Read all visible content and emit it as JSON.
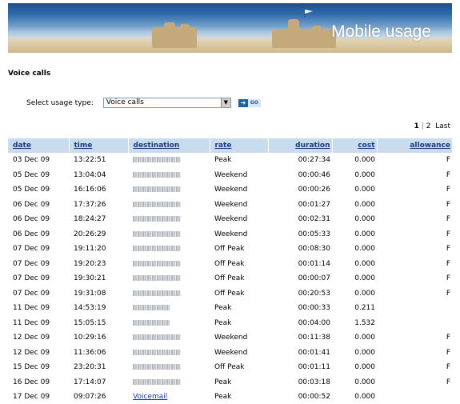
{
  "banner": {
    "title": "Mobile usage"
  },
  "section": {
    "title": "Voice calls"
  },
  "usage_selector": {
    "label": "Select usage type:",
    "value": "Voice calls",
    "go_label": "GO"
  },
  "pager": {
    "current": "1",
    "other": "2",
    "last": "Last"
  },
  "table": {
    "headers": {
      "date": "date",
      "time": "time",
      "destination": "destination",
      "rate": "rate",
      "duration": "duration",
      "cost": "cost",
      "allowance": "allowance"
    },
    "rows": [
      {
        "date": "03 Dec 09",
        "time": "13:22:51",
        "rate": "Peak",
        "duration": "00:27:34",
        "cost": "0.000",
        "allowance": "F"
      },
      {
        "date": "05 Dec 09",
        "time": "13:04:04",
        "rate": "Weekend",
        "duration": "00:00:46",
        "cost": "0.000",
        "allowance": "F"
      },
      {
        "date": "05 Dec 09",
        "time": "16:16:06",
        "rate": "Weekend",
        "duration": "00:00:26",
        "cost": "0.000",
        "allowance": "F"
      },
      {
        "date": "06 Dec 09",
        "time": "17:37:26",
        "rate": "Weekend",
        "duration": "00:01:27",
        "cost": "0.000",
        "allowance": "F"
      },
      {
        "date": "06 Dec 09",
        "time": "18:24:27",
        "rate": "Weekend",
        "duration": "00:02:31",
        "cost": "0.000",
        "allowance": "F"
      },
      {
        "date": "06 Dec 09",
        "time": "20:26:29",
        "rate": "Weekend",
        "duration": "00:05:33",
        "cost": "0.000",
        "allowance": "F"
      },
      {
        "date": "07 Dec 09",
        "time": "19:11:20",
        "rate": "Off Peak",
        "duration": "00:08:30",
        "cost": "0.000",
        "allowance": "F"
      },
      {
        "date": "07 Dec 09",
        "time": "19:20:23",
        "rate": "Off Peak",
        "duration": "00:01:14",
        "cost": "0.000",
        "allowance": "F"
      },
      {
        "date": "07 Dec 09",
        "time": "19:30:21",
        "rate": "Off Peak",
        "duration": "00:00:07",
        "cost": "0.000",
        "allowance": "F"
      },
      {
        "date": "07 Dec 09",
        "time": "19:31:08",
        "rate": "Off Peak",
        "duration": "00:20:53",
        "cost": "0.000",
        "allowance": "F"
      },
      {
        "date": "11 Dec 09",
        "time": "14:53:19",
        "rate": "Peak",
        "duration": "00:00:33",
        "cost": "0.211",
        "allowance": ""
      },
      {
        "date": "11 Dec 09",
        "time": "15:05:15",
        "rate": "Peak",
        "duration": "00:04:00",
        "cost": "1.532",
        "allowance": ""
      },
      {
        "date": "12 Dec 09",
        "time": "10:29:16",
        "rate": "Weekend",
        "duration": "00:11:38",
        "cost": "0.000",
        "allowance": "F"
      },
      {
        "date": "12 Dec 09",
        "time": "11:36:06",
        "rate": "Weekend",
        "duration": "00:01:41",
        "cost": "0.000",
        "allowance": "F"
      },
      {
        "date": "15 Dec 09",
        "time": "23:20:31",
        "rate": "Off Peak",
        "duration": "00:01:11",
        "cost": "0.000",
        "allowance": "F"
      },
      {
        "date": "16 Dec 09",
        "time": "17:14:07",
        "rate": "Peak",
        "duration": "00:03:18",
        "cost": "0.000",
        "allowance": "F"
      },
      {
        "date": "17 Dec 09",
        "time": "09:07:26",
        "rate": "Peak",
        "duration": "00:00:52",
        "cost": "0.000",
        "allowance": "",
        "destination_link": "Voicemail"
      }
    ]
  }
}
